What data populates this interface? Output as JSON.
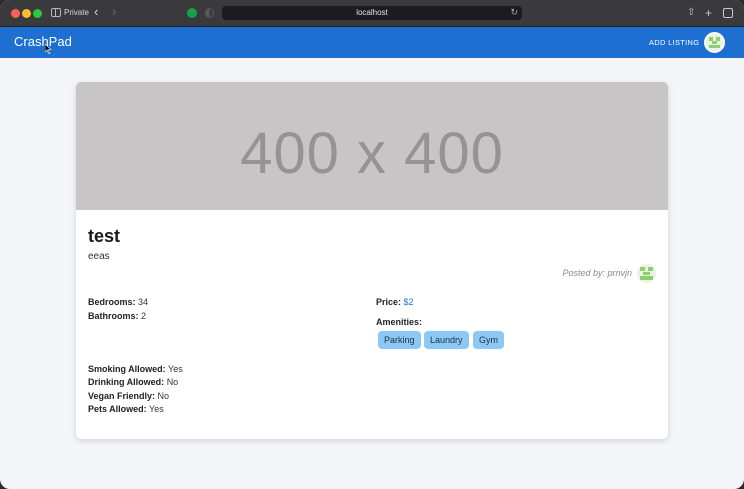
{
  "browser": {
    "private_label": "Private",
    "address": "localhost"
  },
  "app": {
    "brand": "CrashPad",
    "add_listing_label": "ADD LISTING"
  },
  "listing": {
    "image_placeholder": "400 x 400",
    "title": "test",
    "description": "eeas",
    "posted_by": "Posted by: prnvjn",
    "details_left": [
      {
        "label": "Bedrooms:",
        "value": "34"
      },
      {
        "label": "Bathrooms:",
        "value": "2"
      }
    ],
    "price": {
      "label": "Price:",
      "value": "$2"
    },
    "amenities_label": "Amenities:",
    "amenities": [
      "Parking",
      "Laundry",
      "Gym"
    ],
    "rules": [
      {
        "label": "Smoking Allowed:",
        "value": "Yes"
      },
      {
        "label": "Drinking Allowed:",
        "value": "No"
      },
      {
        "label": "Vegan Friendly:",
        "value": "No"
      },
      {
        "label": "Pets Allowed:",
        "value": "Yes"
      }
    ]
  },
  "colors": {
    "navbar": "#1d6fd1",
    "chip": "#8cc8f5",
    "price": "#1d6fd1"
  }
}
